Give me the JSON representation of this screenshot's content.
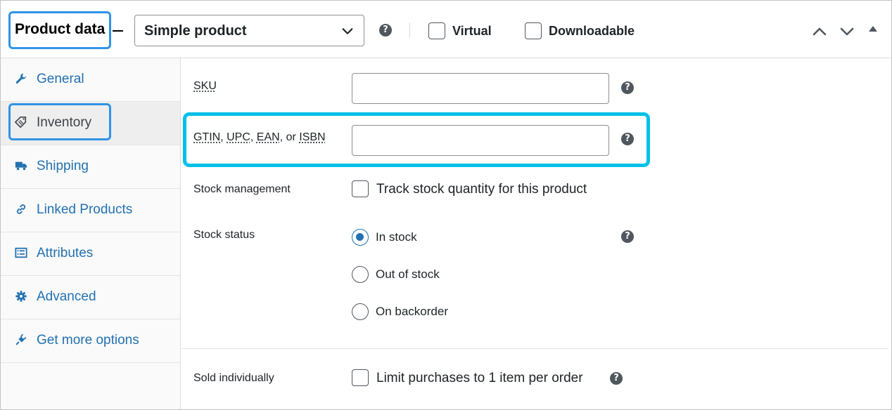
{
  "header": {
    "title": "Product data",
    "product_type": "Simple product",
    "help_glyph": "?",
    "virtual_label": "Virtual",
    "downloadable_label": "Downloadable"
  },
  "sidebar": {
    "items": [
      {
        "label": "General",
        "icon": "wrench-icon"
      },
      {
        "label": "Inventory",
        "icon": "tag-icon",
        "active": true
      },
      {
        "label": "Shipping",
        "icon": "truck-icon"
      },
      {
        "label": "Linked Products",
        "icon": "link-icon"
      },
      {
        "label": "Attributes",
        "icon": "list-icon"
      },
      {
        "label": "Advanced",
        "icon": "gear-icon"
      },
      {
        "label": "Get more options",
        "icon": "plugin-icon"
      }
    ]
  },
  "inventory": {
    "sku_label": "SKU",
    "sku_value": "",
    "gtin_label_parts": [
      "GTIN",
      "UPC",
      "EAN",
      "ISBN"
    ],
    "gtin_value": "",
    "stock_management_label": "Stock management",
    "stock_management_option": "Track stock quantity for this product",
    "stock_status_label": "Stock status",
    "stock_status_options": [
      "In stock",
      "Out of stock",
      "On backorder"
    ],
    "stock_status_selected": "In stock",
    "sold_individually_label": "Sold individually",
    "sold_individually_option": "Limit purchases to 1 item per order"
  },
  "colors": {
    "link": "#2271b1",
    "highlight_cyan": "#00c0e8",
    "highlight_blue": "#2f93e6"
  }
}
